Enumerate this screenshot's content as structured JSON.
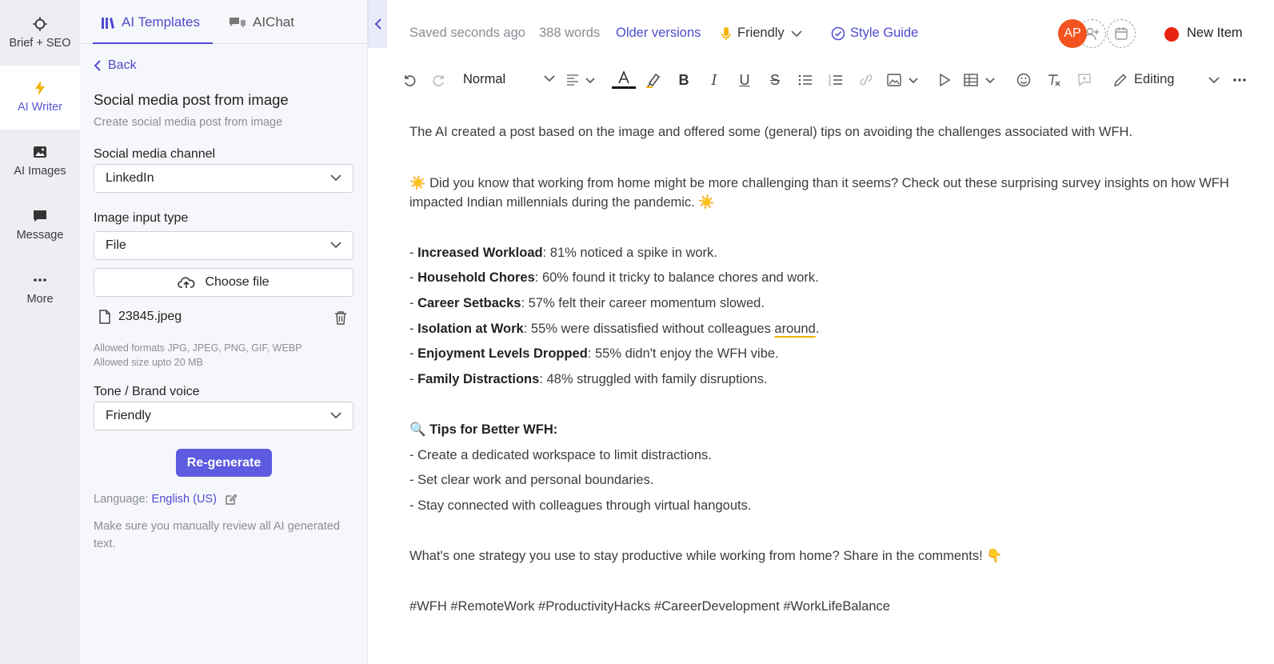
{
  "rail": {
    "items": [
      {
        "label": "Brief + SEO",
        "icon": "target-icon"
      },
      {
        "label": "AI Writer",
        "icon": "lightning-icon"
      },
      {
        "label": "AI Images",
        "icon": "image-icon"
      },
      {
        "label": "Message",
        "icon": "message-icon"
      },
      {
        "label": "More",
        "icon": "more-icon"
      }
    ]
  },
  "panel": {
    "tabs": [
      {
        "label": "AI Templates"
      },
      {
        "label": "AIChat"
      }
    ],
    "back_label": "Back",
    "title": "Social media post from image",
    "subtitle": "Create social media post from image",
    "channel_label": "Social media channel",
    "channel_value": "LinkedIn",
    "input_type_label": "Image input type",
    "input_type_value": "File",
    "choose_file_label": "Choose file",
    "file_name": "23845.jpeg",
    "allowed_formats": "Allowed formats JPG, JPEG, PNG, GIF, WEBP",
    "allowed_size": "Allowed size upto 20 MB",
    "tone_label": "Tone / Brand voice",
    "tone_value": "Friendly",
    "regenerate_label": "Re-generate",
    "language_label": "Language:",
    "language_value": "English (US)",
    "review_note": "Make sure you manually review all AI generated text."
  },
  "topbar": {
    "saved": "Saved seconds ago",
    "words": "388 words",
    "older_versions": "Older versions",
    "tone": "Friendly",
    "style_guide": "Style Guide",
    "avatar_initials": "AP",
    "status": "New Item",
    "status_color": "#e8230f"
  },
  "toolbar": {
    "paragraph_style": "Normal",
    "mode": "Editing"
  },
  "editor": {
    "intro": "The AI created a post based on the image and offered some (general) tips on avoiding the challenges associated with WFH.",
    "hook": "☀️ Did you know that working from home might be more challenging than it seems? Check out these surprising survey insights on how WFH impacted Indian millennials during the pandemic. ☀️",
    "stats": [
      {
        "term": "Increased Workload",
        "text": ": 81% noticed a spike in work."
      },
      {
        "term": "Household Chores",
        "text": ": 60% found it tricky to balance chores and work."
      },
      {
        "term": "Career Setbacks",
        "text": ": 57% felt their career momentum slowed."
      },
      {
        "term": "Isolation at Work",
        "text_before": ": 55% were dissatisfied without colleagues ",
        "text_ul": "around",
        "text_after": "."
      },
      {
        "term": "Enjoyment Levels Dropped",
        "text": ": 55% didn't enjoy the WFH vibe."
      },
      {
        "term": "Family Distractions",
        "text": ": 48% struggled with family disruptions."
      }
    ],
    "tips_heading": "🔍 Tips for Better WFH:",
    "tips": [
      "- Create a dedicated workspace to limit distractions.",
      "- Set clear work and personal boundaries.",
      "- Stay connected with colleagues through virtual hangouts."
    ],
    "question": "What's one strategy you use to stay productive while working from home? Share in the comments! 👇",
    "hashtags": "#WFH #RemoteWork #ProductivityHacks #CareerDevelopment #WorkLifeBalance"
  }
}
